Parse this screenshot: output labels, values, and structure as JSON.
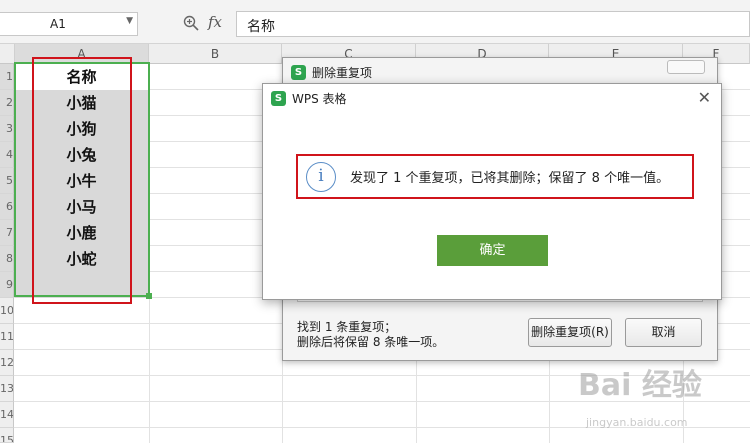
{
  "formula_bar": {
    "cell_ref": "A1",
    "fx": "fx",
    "value": "名称"
  },
  "columns": [
    "A",
    "B",
    "C",
    "D",
    "E",
    "F"
  ],
  "rows": [
    "1",
    "2",
    "3",
    "4",
    "5",
    "6",
    "7",
    "8",
    "9",
    "10",
    "11",
    "12",
    "13",
    "14",
    "15"
  ],
  "column_a_cells": [
    "名称",
    "小猫",
    "小狗",
    "小兔",
    "小牛",
    "小马",
    "小鹿",
    "小蛇"
  ],
  "back_dialog": {
    "title": "删除重复项",
    "info_line1": "找到 1 条重复项；",
    "info_line2": "删除后将保留 8 条唯一项。",
    "delete_button": "删除重复项(R)",
    "cancel_button": "取消"
  },
  "front_dialog": {
    "title": "WPS 表格",
    "close": "✕",
    "message": "发现了 1 个重复项，已将其删除；保留了 8 个唯一值。",
    "ok_button": "确定"
  },
  "logo_letter": "S",
  "watermark": {
    "brand": "Bai 经验",
    "url": "jingyan.baidu.com"
  },
  "colors": {
    "selection_green": "#4caf50",
    "highlight_red": "#d0141b",
    "ok_green": "#5a9e3a",
    "logo_green": "#2ea44f"
  }
}
